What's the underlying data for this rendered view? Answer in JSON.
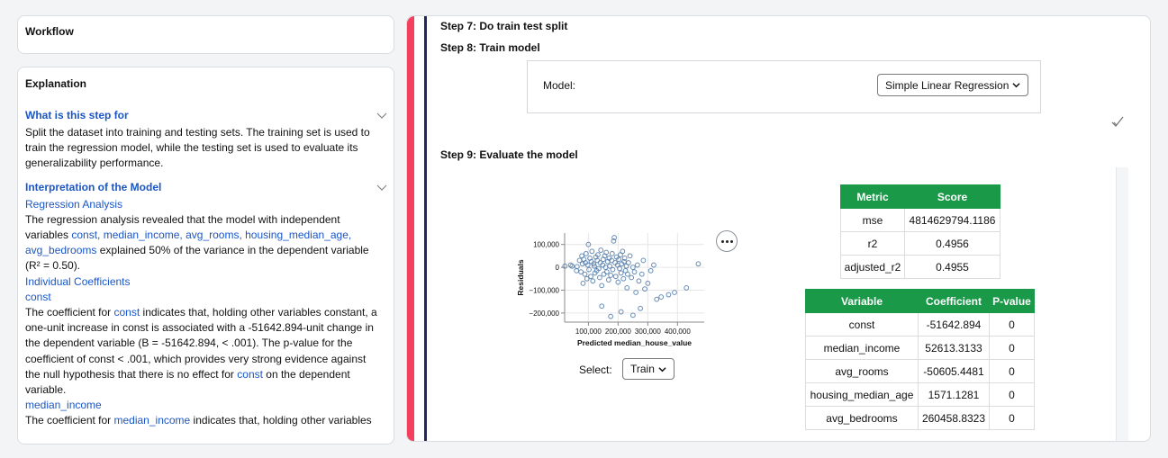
{
  "workflow": {
    "title": "Workflow"
  },
  "explanation": {
    "title": "Explanation",
    "section1": {
      "heading": "What is this step for",
      "body": "Split the dataset into training and testing sets. The training set is used to train the regression model, while the testing set is used to evaluate its generalizability performance."
    },
    "section2": {
      "heading": "Interpretation of the Model",
      "regression_heading": "Regression Analysis",
      "regression_pre": "The regression analysis revealed that the model with independent variables ",
      "regression_vars": "const, median_income, avg_rooms, housing_median_age, avg_bedrooms",
      "regression_post": " explained 50% of the variance in the dependent variable (R² = 0.50).",
      "coef_heading": "Individual Coefficients",
      "const_heading": "const",
      "const_p1": "The coefficient for ",
      "const_var": "const",
      "const_p2": " indicates that, holding other variables constant, a one-unit increase in const is associated with a -51642.894-unit change in the dependent variable (B = -51642.894, < .001). The p-value for the coefficient of const < .001, which provides very strong evidence against the null hypothesis that there is no effect for ",
      "const_var2": "const",
      "const_p3": " on the dependent variable.",
      "mi_heading": "median_income",
      "mi_p1": "The coefficient for ",
      "mi_var": "median_income",
      "mi_p2": " indicates that, holding other variables"
    }
  },
  "main": {
    "step7": "Step 7: Do train test split",
    "step8": "Step 8: Train model",
    "model_label": "Model:",
    "model_value": "Simple Linear Regression",
    "step9": "Step 9: Evaluate the model",
    "select_label": "Select:",
    "select_value": "Train"
  },
  "metrics": {
    "headers": [
      "Metric",
      "Score"
    ],
    "rows": [
      [
        "mse",
        "4814629794.1186"
      ],
      [
        "r2",
        "0.4956"
      ],
      [
        "adjusted_r2",
        "0.4955"
      ]
    ]
  },
  "coefficients": {
    "headers": [
      "Variable",
      "Coefficient",
      "P-value"
    ],
    "rows": [
      [
        "const",
        "-51642.894",
        "0"
      ],
      [
        "median_income",
        "52613.3133",
        "0"
      ],
      [
        "avg_rooms",
        "-50605.4481",
        "0"
      ],
      [
        "housing_median_age",
        "1571.1281",
        "0"
      ],
      [
        "avg_bedrooms",
        "260458.8323",
        "0"
      ]
    ]
  },
  "chart_data": {
    "type": "scatter",
    "xlabel": "Predicted median_house_value",
    "ylabel": "Residuals",
    "xticks": [
      "100,000",
      "200,000",
      "300,000",
      "400,000"
    ],
    "yticks": [
      "100,000",
      "0",
      "−100,000",
      "−200,000"
    ],
    "xlim": [
      20000,
      490000
    ],
    "ylim": [
      -240000,
      150000
    ],
    "grid": true,
    "color": "#4c78a8",
    "points": [
      [
        21000,
        5000
      ],
      [
        40000,
        10000
      ],
      [
        45000,
        5000
      ],
      [
        60000,
        -15000
      ],
      [
        62000,
        3000
      ],
      [
        70000,
        30000
      ],
      [
        75000,
        -20000
      ],
      [
        78000,
        50000
      ],
      [
        80000,
        15000
      ],
      [
        82000,
        -70000
      ],
      [
        85000,
        35000
      ],
      [
        88000,
        -30000
      ],
      [
        90000,
        20000
      ],
      [
        92000,
        60000
      ],
      [
        95000,
        -50000
      ],
      [
        98000,
        10000
      ],
      [
        100000,
        100000
      ],
      [
        102000,
        -10000
      ],
      [
        105000,
        40000
      ],
      [
        108000,
        -40000
      ],
      [
        110000,
        25000
      ],
      [
        112000,
        70000
      ],
      [
        115000,
        -60000
      ],
      [
        118000,
        15000
      ],
      [
        120000,
        5000
      ],
      [
        122000,
        -25000
      ],
      [
        125000,
        45000
      ],
      [
        128000,
        -15000
      ],
      [
        130000,
        30000
      ],
      [
        132000,
        55000
      ],
      [
        135000,
        -5000
      ],
      [
        138000,
        -45000
      ],
      [
        140000,
        20000
      ],
      [
        142000,
        75000
      ],
      [
        145000,
        -80000
      ],
      [
        148000,
        10000
      ],
      [
        150000,
        35000
      ],
      [
        152000,
        -30000
      ],
      [
        155000,
        50000
      ],
      [
        158000,
        0
      ],
      [
        160000,
        65000
      ],
      [
        162000,
        -20000
      ],
      [
        165000,
        25000
      ],
      [
        168000,
        -55000
      ],
      [
        170000,
        40000
      ],
      [
        172000,
        5000
      ],
      [
        175000,
        -35000
      ],
      [
        178000,
        30000
      ],
      [
        180000,
        60000
      ],
      [
        182000,
        -10000
      ],
      [
        185000,
        115000
      ],
      [
        187000,
        130000
      ],
      [
        190000,
        20000
      ],
      [
        192000,
        -40000
      ],
      [
        195000,
        45000
      ],
      [
        198000,
        10000
      ],
      [
        200000,
        -65000
      ],
      [
        202000,
        35000
      ],
      [
        205000,
        -5000
      ],
      [
        208000,
        55000
      ],
      [
        210000,
        -25000
      ],
      [
        212000,
        15000
      ],
      [
        215000,
        70000
      ],
      [
        218000,
        -50000
      ],
      [
        220000,
        25000
      ],
      [
        222000,
        40000
      ],
      [
        225000,
        -15000
      ],
      [
        228000,
        5000
      ],
      [
        230000,
        -90000
      ],
      [
        232000,
        -30000
      ],
      [
        235000,
        20000
      ],
      [
        240000,
        50000
      ],
      [
        245000,
        -45000
      ],
      [
        250000,
        0
      ],
      [
        255000,
        -20000
      ],
      [
        260000,
        -110000
      ],
      [
        265000,
        10000
      ],
      [
        270000,
        -60000
      ],
      [
        275000,
        -180000
      ],
      [
        280000,
        -30000
      ],
      [
        285000,
        30000
      ],
      [
        290000,
        -95000
      ],
      [
        300000,
        -70000
      ],
      [
        310000,
        -15000
      ],
      [
        320000,
        10000
      ],
      [
        330000,
        -140000
      ],
      [
        345000,
        -130000
      ],
      [
        370000,
        -120000
      ],
      [
        390000,
        -110000
      ],
      [
        430000,
        -90000
      ],
      [
        470000,
        15000
      ],
      [
        210000,
        -195000
      ],
      [
        175000,
        -215000
      ],
      [
        145000,
        -170000
      ],
      [
        250000,
        -210000
      ]
    ]
  }
}
